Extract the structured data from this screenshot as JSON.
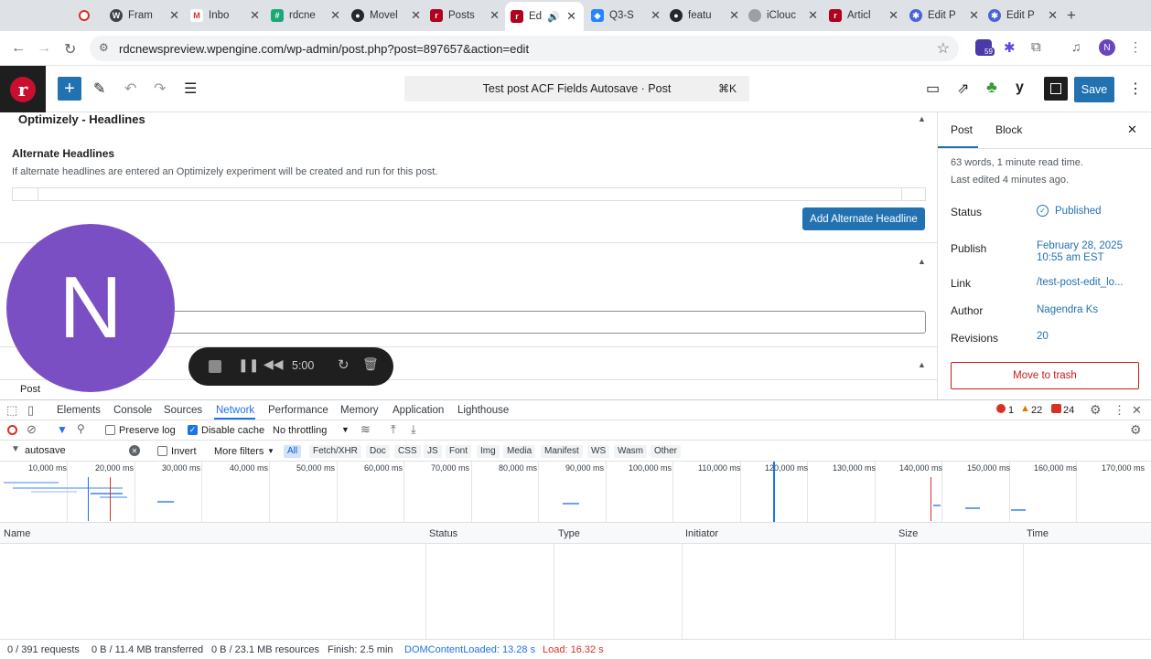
{
  "browser": {
    "tabs": [
      {
        "label": "",
        "icon": "record-icon"
      },
      {
        "label": "Fram",
        "icon": "wordpress-icon"
      },
      {
        "label": "Inbo",
        "icon": "gmail-icon"
      },
      {
        "label": "rdcne",
        "icon": "grid-icon"
      },
      {
        "label": "Movel",
        "icon": "github-icon"
      },
      {
        "label": "Posts",
        "icon": "rdc-icon"
      },
      {
        "label": "Ed",
        "icon": "rdc-icon",
        "active": true
      },
      {
        "label": "Q3-S",
        "icon": "jira-icon"
      },
      {
        "label": "featu",
        "icon": "github-icon"
      },
      {
        "label": "iClouc",
        "icon": "apple-icon"
      },
      {
        "label": "Articl",
        "icon": "rdc-icon"
      },
      {
        "label": "Edit P",
        "icon": "gear-icon"
      },
      {
        "label": "Edit P",
        "icon": "gear-icon"
      }
    ],
    "url": "rdcnewspreview.wpengine.com/wp-admin/post.php?post=897657&action=edit",
    "extension_badge": "59",
    "profile_initial": "N"
  },
  "wp": {
    "doc_title": "Test post ACF Fields Autosave · Post",
    "shortcut": "⌘K",
    "save_label": "Save",
    "logo_letter": "r"
  },
  "editor": {
    "panel1_title": "Optimizely - Headlines",
    "field_label": "Alternate Headlines",
    "field_help": "If alternate headlines are entered an Optimizely experiment will be created and run for this post.",
    "add_button": "Add Alternate Headline",
    "bottom_label": "Post"
  },
  "overlay": {
    "avatar_letter": "N",
    "timer": "5:00"
  },
  "sidebar": {
    "tab_post": "Post",
    "tab_block": "Block",
    "summary": "63 words, 1 minute read time.",
    "last_edited": "Last edited 4 minutes ago.",
    "rows": [
      {
        "label": "Status",
        "value": "Published"
      },
      {
        "label": "Publish",
        "value": "February 28, 2025",
        "value2": "10:55 am EST"
      },
      {
        "label": "Link",
        "value": "/test-post-edit_lo..."
      },
      {
        "label": "Author",
        "value": "Nagendra Ks"
      },
      {
        "label": "Revisions",
        "value": "20"
      }
    ],
    "trash_label": "Move to trash"
  },
  "devtools": {
    "tabs": [
      "Elements",
      "Console",
      "Sources",
      "Network",
      "Performance",
      "Memory",
      "Application",
      "Lighthouse"
    ],
    "active_tab": "Network",
    "errors": "1",
    "warnings": "22",
    "issues": "24",
    "preserve_log": "Preserve log",
    "disable_cache": "Disable cache",
    "throttling": "No throttling",
    "filter_value": "autosave",
    "invert": "Invert",
    "more_filters": "More filters",
    "type_filters": [
      "All",
      "Fetch/XHR",
      "Doc",
      "CSS",
      "JS",
      "Font",
      "Img",
      "Media",
      "Manifest",
      "WS",
      "Wasm",
      "Other"
    ],
    "timeline_ticks": [
      "10,000 ms",
      "20,000 ms",
      "30,000 ms",
      "40,000 ms",
      "50,000 ms",
      "60,000 ms",
      "70,000 ms",
      "80,000 ms",
      "90,000 ms",
      "100,000 ms",
      "110,000 ms",
      "120,000 ms",
      "130,000 ms",
      "140,000 ms",
      "150,000 ms",
      "160,000 ms",
      "170,000 ms"
    ],
    "columns": [
      "Name",
      "Status",
      "Type",
      "Initiator",
      "Size",
      "Time"
    ],
    "status": {
      "requests": "0 / 391 requests",
      "transferred": "0 B / 11.4 MB transferred",
      "resources": "0 B / 23.1 MB resources",
      "finish": "Finish: 2.5 min",
      "dcl": "DOMContentLoaded: 13.28 s",
      "load": "Load: 16.32 s"
    }
  },
  "colors": {
    "wp_blue": "#2271b1",
    "avatar": "#7b4fc4",
    "devtools_blue": "#1a73e8",
    "load_red": "#d93025"
  }
}
